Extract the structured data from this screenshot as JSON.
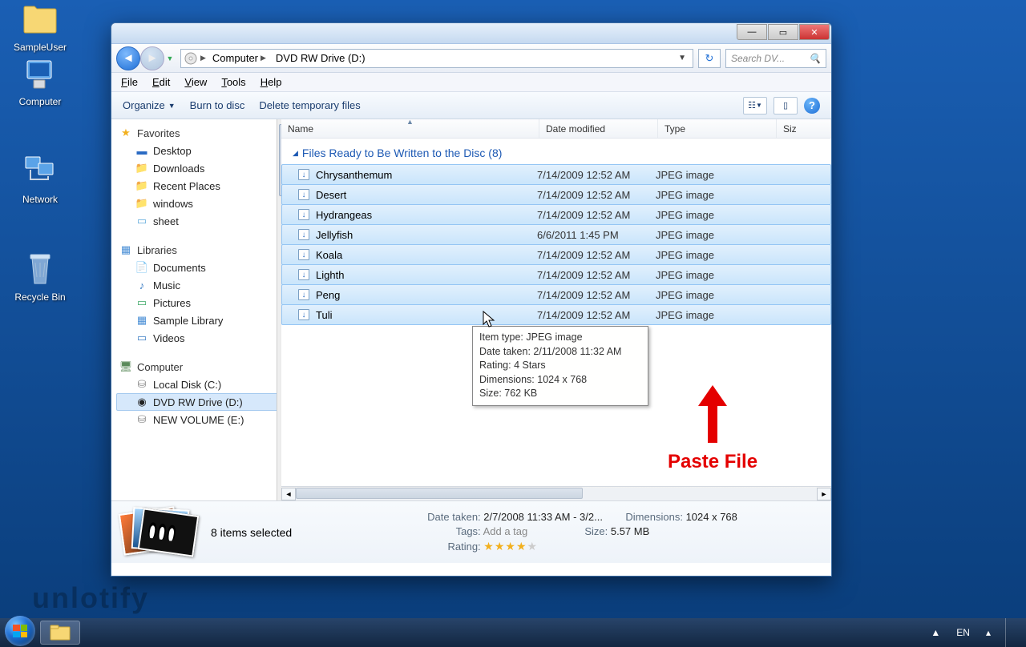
{
  "desktop": {
    "user_label": "SampleUser",
    "icons": {
      "computer": "Computer",
      "network": "Network",
      "recycle": "Recycle Bin"
    }
  },
  "watermark": "unlotify",
  "window": {
    "breadcrumb": {
      "root": "Computer",
      "drive": "DVD RW Drive (D:)"
    },
    "search_placeholder": "Search DV...",
    "menu": {
      "file": "File",
      "edit": "Edit",
      "view": "View",
      "tools": "Tools",
      "help": "Help"
    },
    "toolbar": {
      "organize": "Organize",
      "burn": "Burn to disc",
      "delete_temp": "Delete temporary files"
    },
    "sidebar": {
      "favorites": {
        "header": "Favorites",
        "items": [
          "Desktop",
          "Downloads",
          "Recent Places",
          "windows",
          "sheet"
        ]
      },
      "libraries": {
        "header": "Libraries",
        "items": [
          "Documents",
          "Music",
          "Pictures",
          "Sample Library",
          "Videos"
        ]
      },
      "computer": {
        "header": "Computer",
        "items": [
          "Local Disk (C:)",
          "DVD RW Drive (D:)",
          "NEW VOLUME (E:)"
        ]
      }
    },
    "columns": {
      "name": "Name",
      "date": "Date modified",
      "type": "Type",
      "size": "Siz"
    },
    "group_header": "Files Ready to Be Written to the Disc (8)",
    "files": [
      {
        "name": "Chrysanthemum",
        "date": "7/14/2009 12:52 AM",
        "type": "JPEG image"
      },
      {
        "name": "Desert",
        "date": "7/14/2009 12:52 AM",
        "type": "JPEG image"
      },
      {
        "name": "Hydrangeas",
        "date": "7/14/2009 12:52 AM",
        "type": "JPEG image"
      },
      {
        "name": "Jellyfish",
        "date": "6/6/2011 1:45 PM",
        "type": "JPEG image"
      },
      {
        "name": "Koala",
        "date": "7/14/2009 12:52 AM",
        "type": "JPEG image"
      },
      {
        "name": "Lighth",
        "date": "7/14/2009 12:52 AM",
        "type": "JPEG image"
      },
      {
        "name": "Peng",
        "date": "7/14/2009 12:52 AM",
        "type": "JPEG image"
      },
      {
        "name": "Tuli",
        "date": "7/14/2009 12:52 AM",
        "type": "JPEG image"
      }
    ],
    "tooltip": {
      "l1": "Item type: JPEG image",
      "l2": "Date taken: 2/11/2008 11:32 AM",
      "l3": "Rating: 4 Stars",
      "l4": "Dimensions: 1024 x 768",
      "l5": "Size: 762 KB"
    },
    "details": {
      "summary": "8 items selected",
      "date_label": "Date taken:",
      "date_val": "2/7/2008 11:33 AM - 3/2...",
      "tags_label": "Tags:",
      "tags_val": "Add a tag",
      "rating_label": "Rating:",
      "dim_label": "Dimensions:",
      "dim_val": "1024 x 768",
      "size_label": "Size:",
      "size_val": "5.57 MB"
    }
  },
  "annotation": "Paste File",
  "taskbar": {
    "lang": "EN"
  }
}
